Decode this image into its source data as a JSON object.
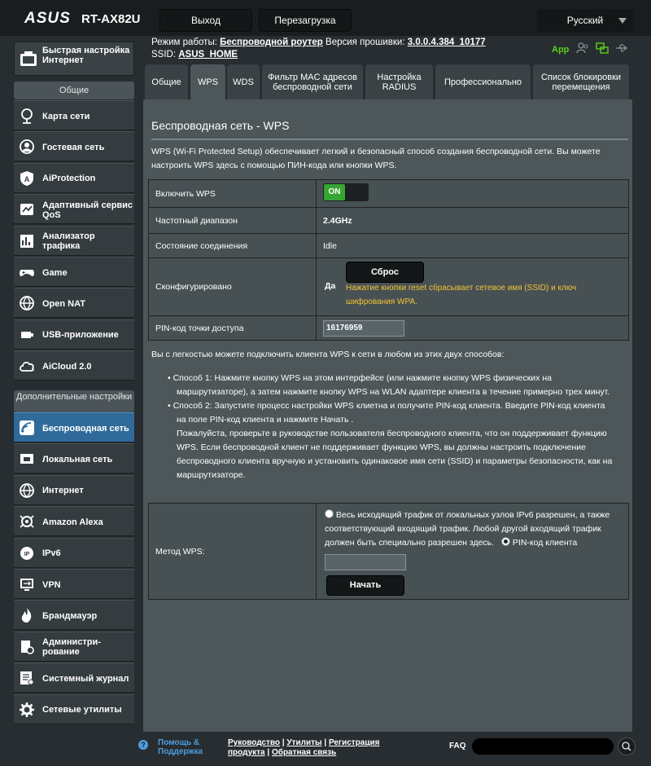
{
  "header": {
    "logo": "ASUS",
    "model": "RT-AX82U",
    "logout": "Выход",
    "reboot": "Перезагрузка",
    "language": "Русский"
  },
  "status": {
    "mode_label": "Режим работы:",
    "mode_value": "Беспроводной роутер",
    "fw_label": "Версия прошивки:",
    "fw_value": "3.0.0.4.384_10177",
    "ssid_label": "SSID:",
    "ssid_value": "ASUS_HOME",
    "app": "App"
  },
  "sidebar": {
    "qis": "Быстрая настройка Интернет",
    "general_header": "Общие",
    "general_items": [
      {
        "label": "Карта сети",
        "icon": "network-map-icon"
      },
      {
        "label": "Гостевая сеть",
        "icon": "guest-network-icon"
      },
      {
        "label": "AiProtection",
        "icon": "shield-icon"
      },
      {
        "label": "Адаптивный сервис QoS",
        "icon": "qos-icon"
      },
      {
        "label": "Анализатор трафика",
        "icon": "traffic-analyzer-icon"
      },
      {
        "label": "Game",
        "icon": "gamepad-icon"
      },
      {
        "label": "Open NAT",
        "icon": "globe-icon"
      },
      {
        "label": "USB-приложение",
        "icon": "usb-icon"
      },
      {
        "label": "AiCloud 2.0",
        "icon": "cloud-icon"
      }
    ],
    "advanced_header": "Дополнительные настройки",
    "advanced_items": [
      {
        "label": "Беспроводная сеть",
        "icon": "wireless-icon"
      },
      {
        "label": "Локальная сеть",
        "icon": "lan-icon"
      },
      {
        "label": "Интернет",
        "icon": "globe-icon"
      },
      {
        "label": "Amazon Alexa",
        "icon": "alexa-icon"
      },
      {
        "label": "IPv6",
        "icon": "ipv6-icon"
      },
      {
        "label": "VPN",
        "icon": "vpn-icon"
      },
      {
        "label": "Брандмауэр",
        "icon": "firewall-icon"
      },
      {
        "label": "Администри-рование",
        "icon": "admin-icon"
      },
      {
        "label": "Системный журнал",
        "icon": "system-log-icon"
      },
      {
        "label": "Сетевые утилиты",
        "icon": "gear-icon"
      }
    ]
  },
  "tabs": [
    {
      "label": "Общие"
    },
    {
      "label": "WPS"
    },
    {
      "label": "WDS"
    },
    {
      "label": "Фильтр MAC адресов беспроводной сети"
    },
    {
      "label": "Настройка RADIUS"
    },
    {
      "label": "Профессионально"
    },
    {
      "label": "Список блокировки перемещения"
    }
  ],
  "main": {
    "title": "Беспроводная сеть - WPS",
    "desc1": "WPS (Wi-Fi Protected Setup) обеспечивает легкий и безопасный способ создания беспроводной сети. Вы можете",
    "desc2": "настроить WPS здесь с помощью ПИН-кода или кнопки WPS.",
    "rows": {
      "enable_label": "Включить WPS",
      "enable_value": "ON",
      "band_label": "Частотный диапазон",
      "band_value": "2.4GHz",
      "conn_label": "Состояние соединения",
      "conn_value": "Idle",
      "configured_label": "Сконфигурировано",
      "configured_value": "Да",
      "reset_button": "Сброс",
      "reset_note1": "Нажатие кнопки reset сбрасывает сетевое имя (SSID) и ключ",
      "reset_note2": "шифрования WPA.",
      "pin_label": "PIN-код точки доступа",
      "pin_value": "16176959"
    },
    "ways_intro": "Вы с легкостью можете подключить клиента WPS к сети в любом из этих двух способов:",
    "way1_line1": "Способ 1: Нажмите кнопку WPS на этом интерфейсе (или нажмите кнопку WPS физических на",
    "way1_line2": "маршрутизаторе), а затем нажмите кнопку WPS на WLAN адаптере клиента в течение примерно трех минут.",
    "way2_line1": "Способ 2: Запустите процесс настройки WPS клиетна и получите PIN-код клиента. Введите PIN-код клиента",
    "way2_line2": "на поле PIN-код клиента и нажмите Начать .",
    "way2_line3": "Пожалуйста, проверьте в руководстве пользователя беспроводного клиента, что он поддерживает функцию",
    "way2_line4": "WPS. Если беспроводной клиент не поддерживает функцию WPS, вы должны настроить подключение",
    "way2_line5": "беспроводного клиента вручную и установить одинаковое имя сети (SSID) и параметры безопасности, как на",
    "way2_line6": "маршрутизаторе.",
    "method_label": "Метод WPS:",
    "opt1_line1": "Весь исходящий трафик от локальных узлов IPv6 разрешен, а также",
    "opt1_line2": "соответствующий входящий трафик. Любой другой входящий трафик",
    "opt1_line3": "должен быть специально разрешен здесь.",
    "opt2": "PIN-код клиента",
    "start_button": "Начать"
  },
  "footer": {
    "help1": "Помощь &",
    "help2": "Поддержка",
    "manual": "Руководство",
    "utils": "Утилиты",
    "register1": "Регистрация",
    "register2": "продукта",
    "feedback": "Обратная связь",
    "faq": "FAQ"
  }
}
